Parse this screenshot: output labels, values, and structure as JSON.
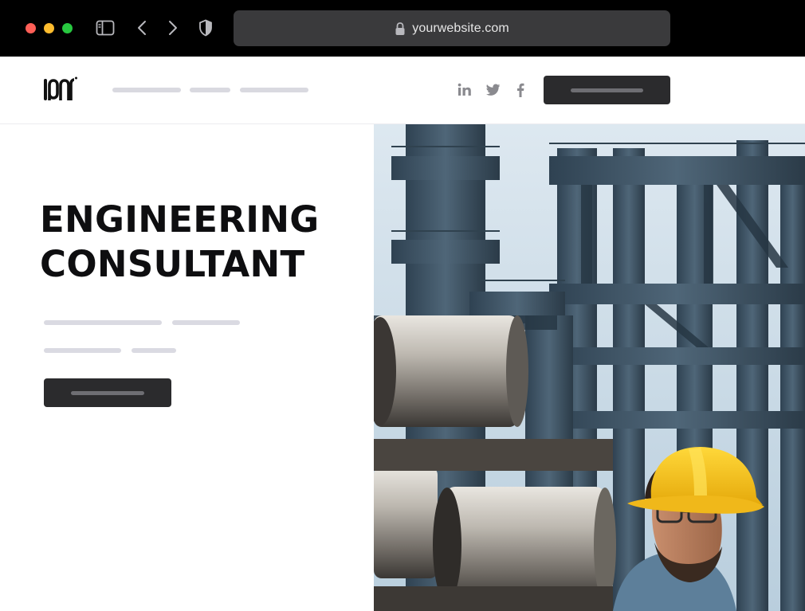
{
  "browser": {
    "url": "yourwebsite.com",
    "icons": [
      "sidebar-icon",
      "chevron-left-icon",
      "chevron-right-icon",
      "shield-icon",
      "lock-icon"
    ]
  },
  "header": {
    "logo_text": "logo",
    "social_icons": [
      "linkedin-icon",
      "twitter-icon",
      "facebook-icon"
    ]
  },
  "hero": {
    "title_line_1": "ENGINEERING",
    "title_line_2": "CONSULTANT"
  },
  "colors": {
    "chrome_bg": "#000000",
    "urlbar_bg": "#3a3a3c",
    "button_dark": "#2b2b2d",
    "placeholder_bar": "#d9d9e0",
    "helmet_yellow": "#f5c518",
    "structure_steel": "#4a5f70",
    "sky": "#c9dbe7"
  }
}
